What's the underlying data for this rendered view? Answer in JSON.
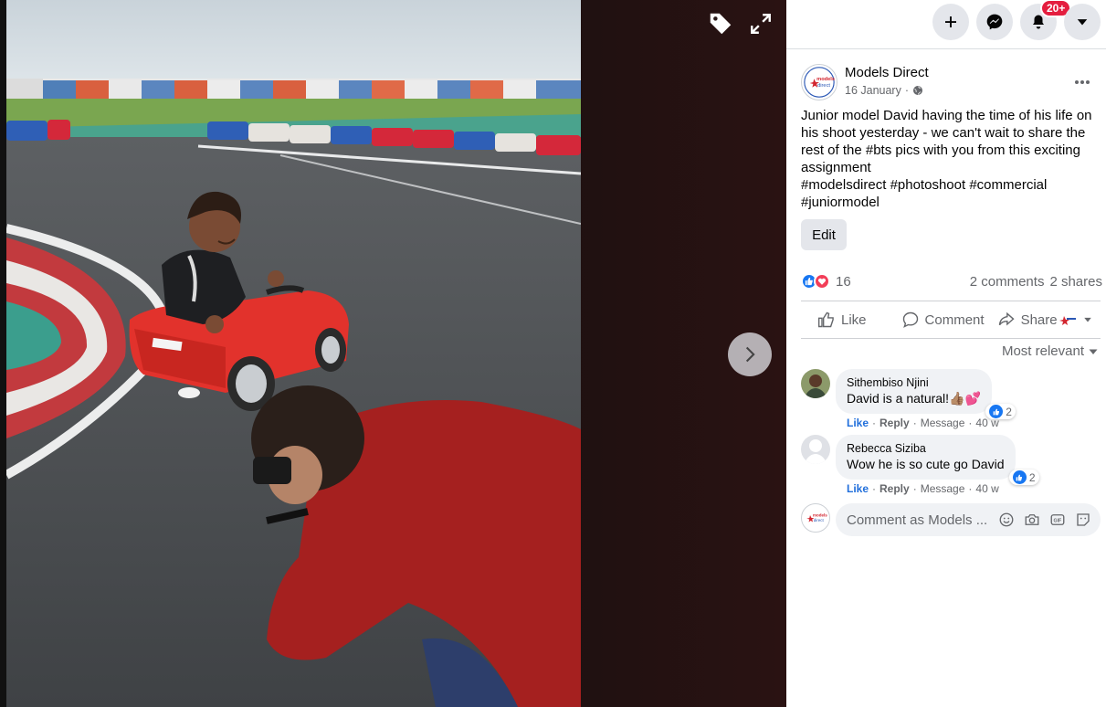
{
  "topbar": {
    "create_icon": "plus-icon",
    "messenger_icon": "messenger-icon",
    "notifications_badge": "20+",
    "account_icon": "caret-down-icon"
  },
  "post": {
    "page_name": "Models Direct",
    "date": "16 January",
    "date_separator": "·",
    "text_intro": "Junior model David having the time of his life on his shoot yesterday - we can't wait to share the rest of the ",
    "text_bts": "#bts",
    "text_mid": " pics with you from this exciting assignment",
    "hashtags": [
      "#modelsdirect",
      "#photoshoot",
      "#commercial",
      "#juniormodel"
    ],
    "edit_label": "Edit",
    "reaction_count": "16",
    "comments_count": "2 comments",
    "shares_count": "2 shares"
  },
  "actions": {
    "like": "Like",
    "comment": "Comment",
    "share": "Share"
  },
  "sort": {
    "label": "Most relevant"
  },
  "comments": [
    {
      "author": "Sithembiso Njini",
      "text": "David is a natural!👍🏽💕",
      "reactions": "2",
      "like": "Like",
      "reply": "Reply",
      "message": "Message",
      "time": "40 w"
    },
    {
      "author": "Rebecca Siziba",
      "text": "Wow he is so cute go David",
      "reactions": "2",
      "like": "Like",
      "reply": "Reply",
      "message": "Message",
      "time": "40 w"
    }
  ],
  "comment_input": {
    "placeholder": "Comment as Models ..."
  },
  "colors": {
    "accent_blue": "#1877f2",
    "like_link": "#216fdb",
    "badge_red": "#e41e3f",
    "panel_gray": "#f0f2f5"
  }
}
